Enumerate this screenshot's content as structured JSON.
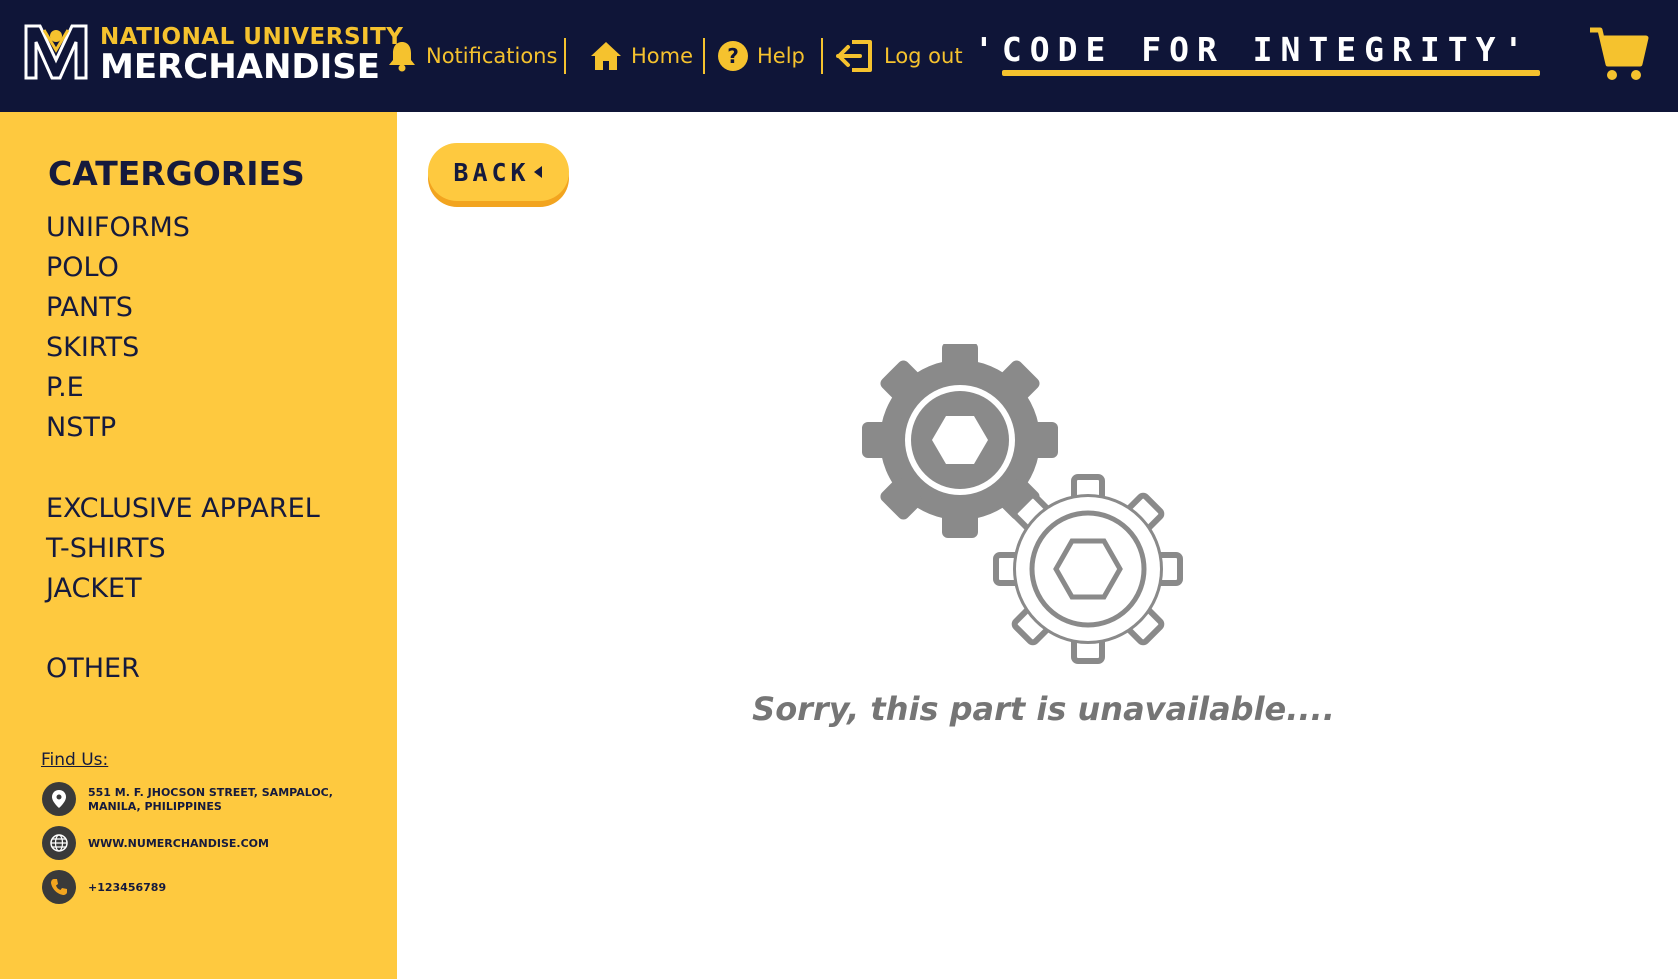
{
  "header": {
    "brand_top": "NATIONAL UNIVERSITY",
    "brand_main": "MERCHANDISE",
    "nav": {
      "notifications": "Notifications",
      "home": "Home",
      "help": "Help",
      "logout": "Log out"
    },
    "slogan": "'CODE FOR INTEGRITY'"
  },
  "sidebar": {
    "title": "CATERGORIES",
    "items": [
      "UNIFORMS",
      "POLO",
      "PANTS",
      "SKIRTS",
      "P.E",
      "NSTP",
      "EXCLUSIVE APPAREL",
      "T-SHIRTS",
      "JACKET",
      "OTHER"
    ],
    "find_us": "Find Us:",
    "contacts": {
      "address": "551 M. F. JHOCSON STREET, SAMPALOC, MANILA, PHILIPPINES",
      "website": "WWW.NUMERCHANDISE.COM",
      "phone": "+123456789"
    }
  },
  "main": {
    "back_label": "BACK",
    "message": "Sorry, this part is unavailable...."
  },
  "colors": {
    "navy": "#0f1538",
    "yellow": "#fec93f",
    "gear_gray": "#8a8a8a"
  }
}
